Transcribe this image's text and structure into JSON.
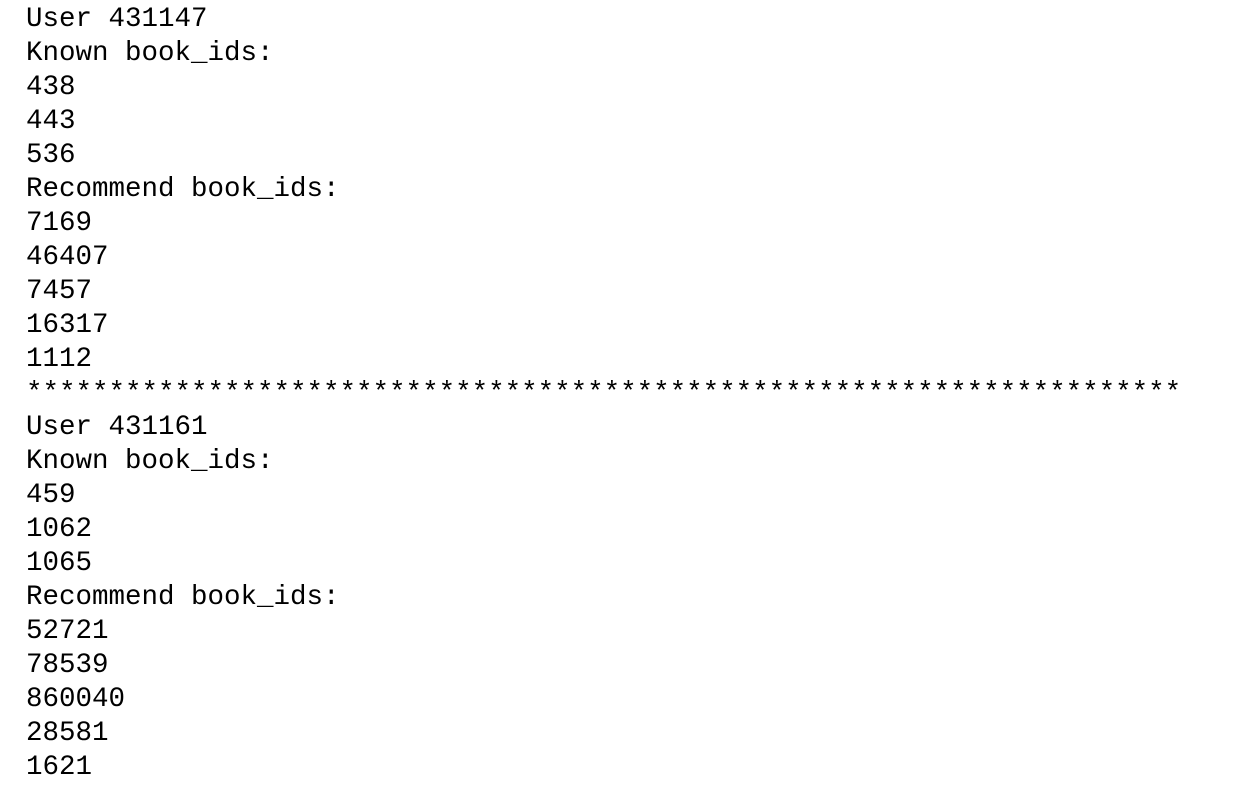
{
  "output": {
    "blocks": [
      {
        "user_line": "User 431147",
        "known_header": "Known book_ids:",
        "known_ids": [
          "438",
          "443",
          "536"
        ],
        "recommend_header": "Recommend book_ids:",
        "recommend_ids": [
          "7169",
          "46407",
          "7457",
          "16317",
          "1112"
        ]
      },
      {
        "user_line": "User 431161",
        "known_header": "Known book_ids:",
        "known_ids": [
          "459",
          "1062",
          "1065"
        ],
        "recommend_header": "Recommend book_ids:",
        "recommend_ids": [
          "52721",
          "78539",
          "860040",
          "28581",
          "1621"
        ]
      }
    ],
    "separator": "**********************************************************************"
  }
}
